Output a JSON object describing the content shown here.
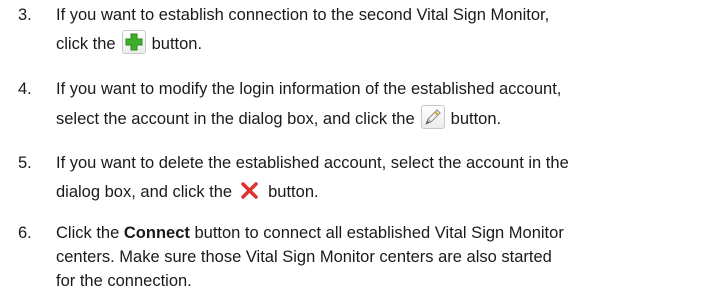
{
  "steps": [
    {
      "number": "3.",
      "line1": "If you want to establish connection to the second Vital Sign Monitor,",
      "line2_before": "click the",
      "line2_after": "button.",
      "icon": "add-icon"
    },
    {
      "number": "4.",
      "line1": "If you want to modify the login information of the established account,",
      "line2_before": "select the account in the dialog box, and click the",
      "line2_after": "button.",
      "icon": "edit-icon"
    },
    {
      "number": "5.",
      "line1": "If you want to delete the established account, select the account in the",
      "line2_before": "dialog box, and click the",
      "line2_after": "button.",
      "icon": "delete-icon"
    },
    {
      "number": "6.",
      "line1_before": "Click the",
      "line1_bold": "Connect",
      "line1_after": "button to connect all established Vital Sign Monitor",
      "line2": "centers. Make sure those Vital Sign Monitor centers are also started",
      "line3": "for the connection."
    }
  ],
  "colors": {
    "text": "#1a1a1a",
    "add_icon": "#3fae2a",
    "delete_icon": "#e03030",
    "edit_icon": "#d9a520"
  }
}
